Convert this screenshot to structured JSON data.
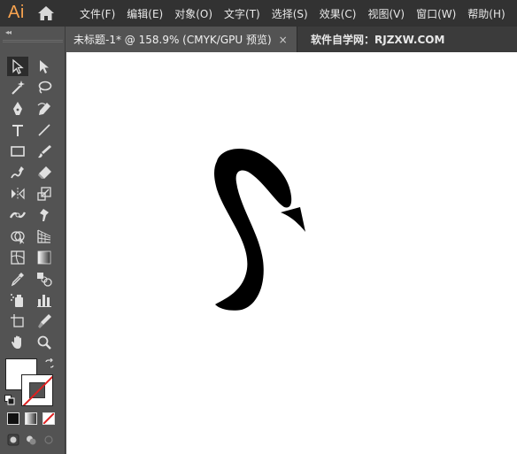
{
  "app": {
    "logo": "Ai"
  },
  "menu": [
    "文件(F)",
    "编辑(E)",
    "对象(O)",
    "文字(T)",
    "选择(S)",
    "效果(C)",
    "视图(V)",
    "窗口(W)",
    "帮助(H)"
  ],
  "tabs": {
    "active": "未标题-1* @ 158.9% (CMYK/GPU 预览)",
    "close_glyph": "×",
    "inactive": "软件自学网：RJZXW.COM"
  },
  "toolbar": {
    "collapse": "◂◂",
    "tools": [
      "selection-tool",
      "direct-selection-tool",
      "magic-wand-tool",
      "lasso-tool",
      "pen-tool",
      "curvature-tool",
      "type-tool",
      "line-segment-tool",
      "rectangle-tool",
      "paintbrush-tool",
      "shaper-tool",
      "eraser-tool",
      "rotate-tool",
      "scale-tool",
      "width-tool",
      "puppet-warp-tool",
      "shape-builder-tool",
      "perspective-grid-tool",
      "mesh-tool",
      "gradient-tool",
      "eyedropper-tool",
      "blend-tool",
      "symbol-sprayer-tool",
      "column-graph-tool",
      "artboard-tool",
      "slice-tool",
      "hand-tool",
      "zoom-tool"
    ]
  },
  "colors": {
    "accent": "#f7a34f",
    "fill": "#ffffff",
    "stroke": "#ffffff",
    "none_slash": "#e02020",
    "artwork": "#000000"
  }
}
